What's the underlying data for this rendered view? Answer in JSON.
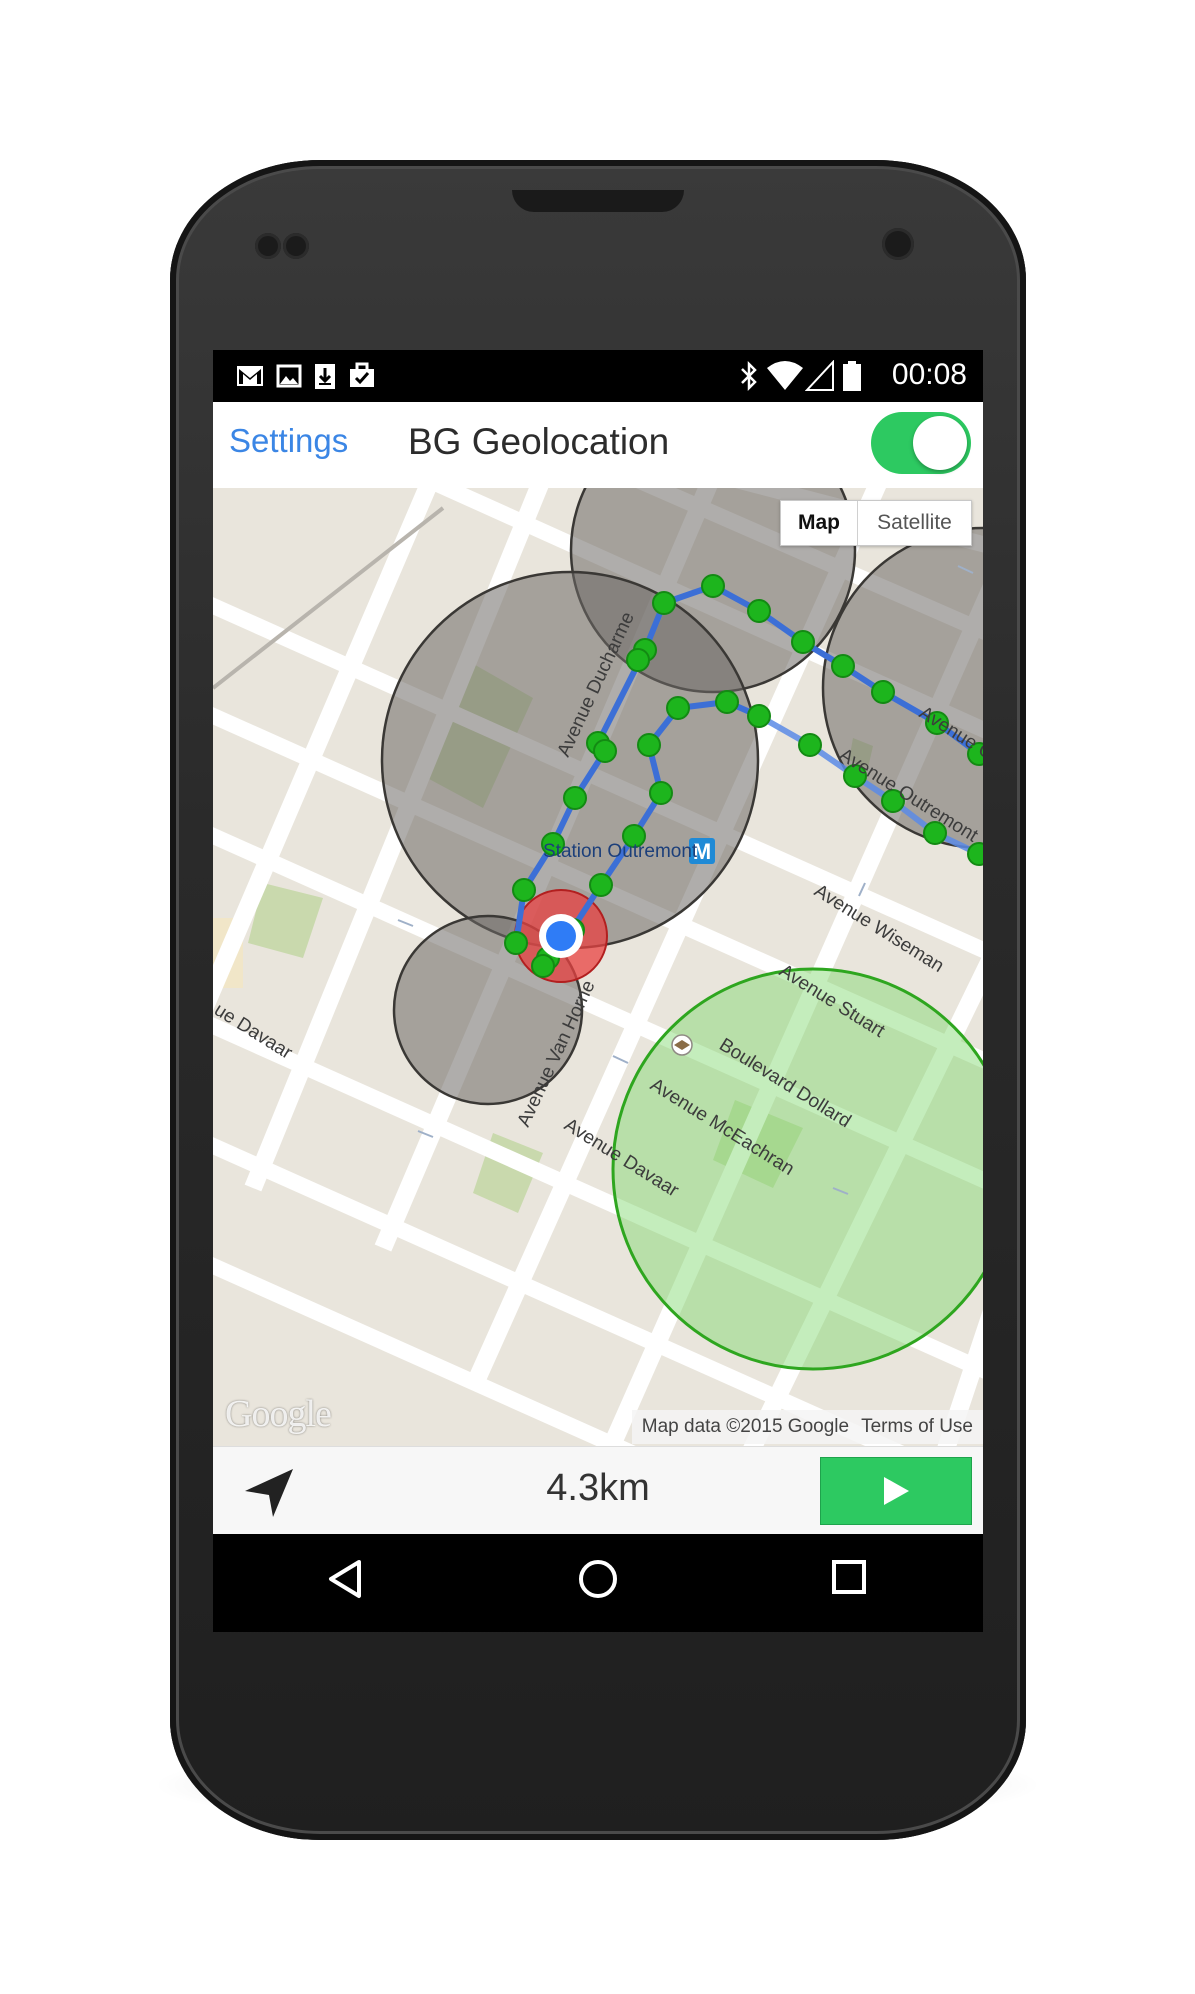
{
  "status_bar": {
    "time": "00:08",
    "icons": [
      "gmail-icon",
      "gallery-icon",
      "download-icon",
      "task-icon",
      "bluetooth-icon",
      "wifi-icon",
      "signal-icon",
      "battery-icon"
    ]
  },
  "header": {
    "settings_label": "Settings",
    "title": "BG Geolocation",
    "tracking_enabled": true,
    "accent_color": "#2dc961",
    "link_color": "#3b86e5"
  },
  "map": {
    "map_type_options": [
      "Map",
      "Satellite"
    ],
    "selected_map_type": "Map",
    "street_labels": [
      "Avenue Ducharme",
      "Station Outremont",
      "Avenue Wiseman",
      "Avenue Stuart",
      "Boulevard Dollard",
      "Avenue McEachran",
      "Avenue Davaar",
      "Avenue Van Horne",
      "Avenue Outremont",
      "Avenue Champagneur",
      "ue Davaar"
    ],
    "google_logo": "Google",
    "attribution": "Map data ©2015 Google",
    "terms": "Terms of Use",
    "route_color": "#3c6fd6",
    "location_point_color": "#1db51d",
    "geofence_color": "#6e6a66",
    "active_geofence_color": "#7cd66a",
    "current_location_color": "#2f7cf6"
  },
  "bottom_bar": {
    "distance": "4.3km",
    "play_button_color": "#2dc961"
  },
  "nav_bar": {
    "buttons": [
      "back-icon",
      "home-icon",
      "recents-icon"
    ]
  }
}
